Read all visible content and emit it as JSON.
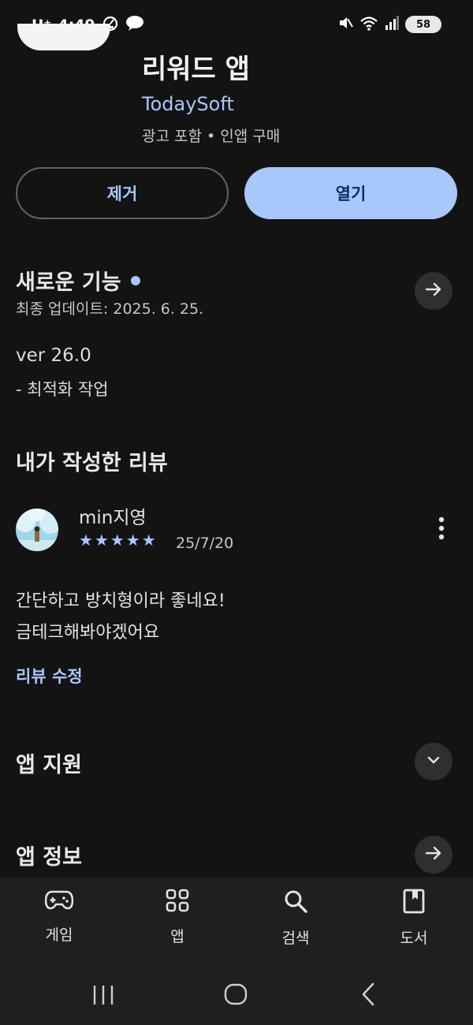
{
  "status_bar": {
    "carrier": "U⁺",
    "time": "4:49",
    "battery": "58",
    "network": "5"
  },
  "app": {
    "title": "리워드 앱",
    "developer": "TodaySoft",
    "meta": "광고 포함  •  인앱 구매"
  },
  "actions": {
    "remove_label": "제거",
    "open_label": "열기"
  },
  "whats_new": {
    "title": "새로운 기능",
    "last_update": "최종 업데이트: 2025. 6. 25.",
    "version": "ver 26.0",
    "note": "- 최적화 작업"
  },
  "my_review": {
    "title": "내가 작성한 리뷰",
    "reviewer": "min지영",
    "stars": "★★★★★",
    "rating": 5,
    "date": "25/7/20",
    "line1": "간단하고 방치형이라 좋네요!",
    "line2": "금테크해봐야겠어요",
    "edit_label": "리뷰 수정"
  },
  "sections": {
    "support": "앱 지원",
    "info": "앱 정보"
  },
  "bottom_nav": [
    {
      "label": "게임",
      "icon": "gamepad-icon"
    },
    {
      "label": "앱",
      "icon": "apps-grid-icon"
    },
    {
      "label": "검색",
      "icon": "search-icon"
    },
    {
      "label": "도서",
      "icon": "book-icon"
    }
  ],
  "colors": {
    "background": "#131314",
    "accent": "#a8c7fa",
    "nav_background": "#1e1f20"
  }
}
